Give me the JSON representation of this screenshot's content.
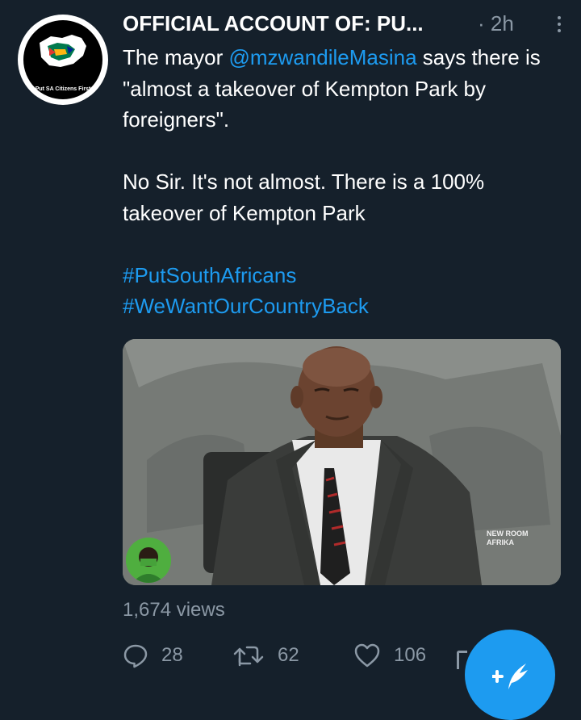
{
  "account": {
    "avatar_caption": "Put SA Citizens First",
    "display_name": "OFFICIAL ACCOUNT OF: PU...",
    "time": "· 2h"
  },
  "tweet": {
    "line1_prefix": "The mayor ",
    "mention": "@mzwandileMasina",
    "line1_suffix": " says there is \"almost a takeover of Kempton Park by foreigners\".",
    "paragraph2": "No Sir. It's not almost. There is a 100% takeover of Kempton Park",
    "hashtag1": "#PutSouthAfricans",
    "hashtag2": "#WeWantOurCountryBack"
  },
  "media": {
    "watermark_line1": "NEW ROOM",
    "watermark_line2": "AFRIKA"
  },
  "stats": {
    "views": "1,674 views",
    "replies": "28",
    "retweets": "62",
    "likes": "106"
  },
  "colors": {
    "background": "#15202b",
    "accent": "#1d9bf0",
    "muted": "#8b98a5"
  },
  "icons": [
    "more-icon",
    "reply-icon",
    "retweet-icon",
    "like-icon",
    "share-icon",
    "compose-icon"
  ]
}
